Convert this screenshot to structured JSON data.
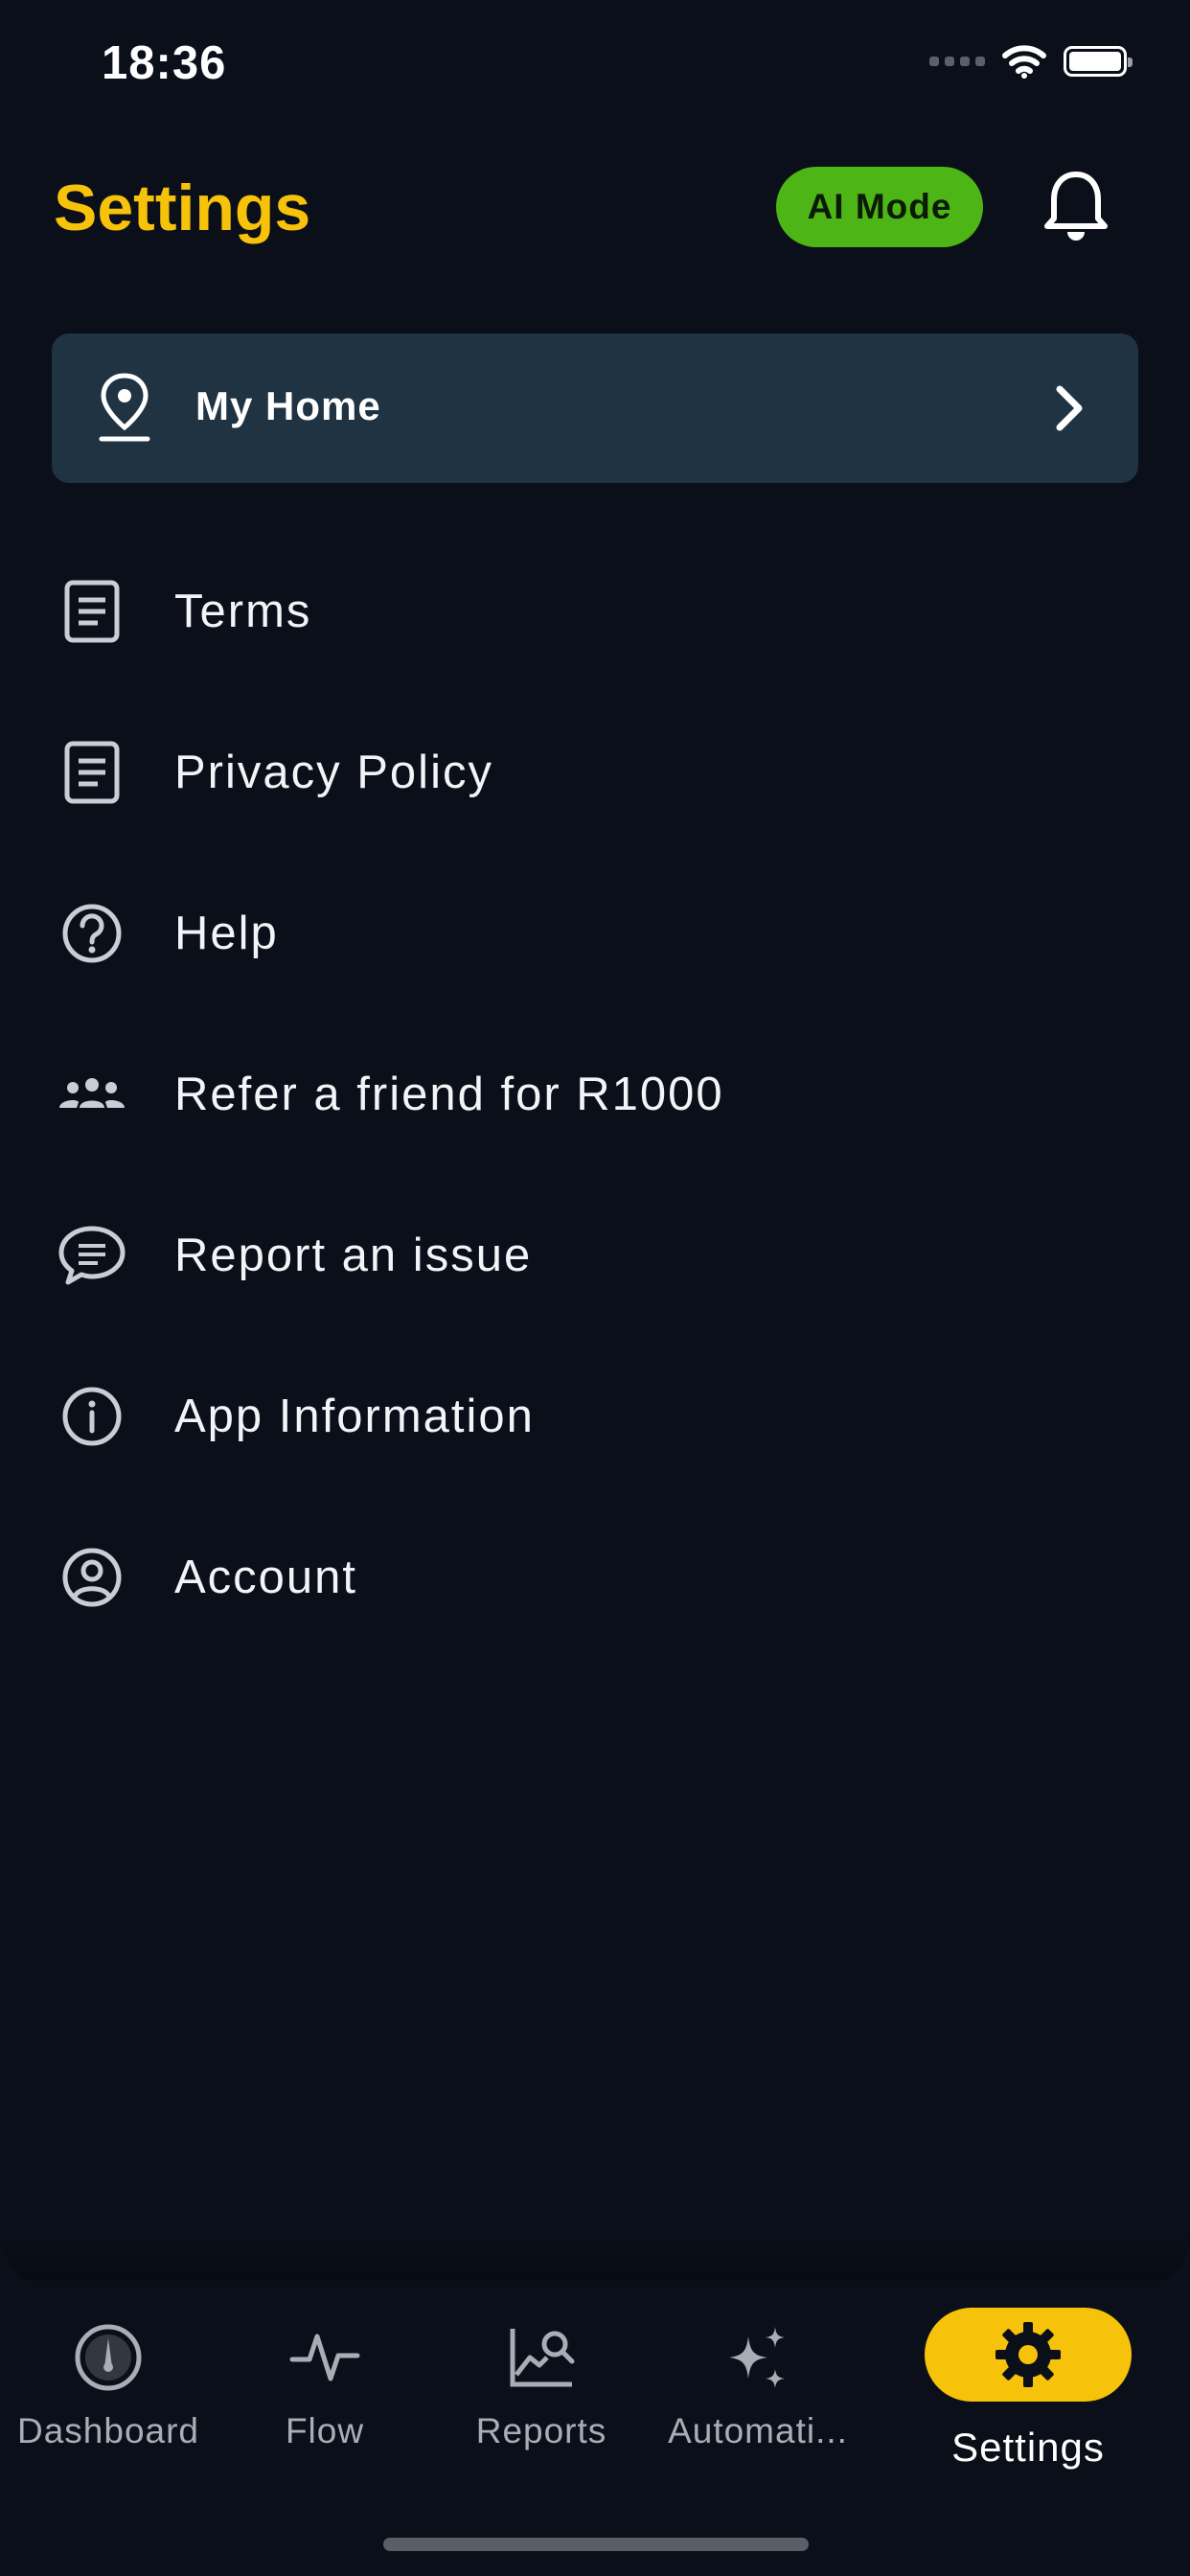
{
  "status_bar": {
    "time": "18:36"
  },
  "header": {
    "title": "Settings",
    "ai_mode_label": "AI Mode"
  },
  "home_card": {
    "label": "My Home"
  },
  "menu": {
    "items": [
      {
        "label": "Terms",
        "icon": "document-icon"
      },
      {
        "label": "Privacy Policy",
        "icon": "document-icon"
      },
      {
        "label": "Help",
        "icon": "question-circle-icon"
      },
      {
        "label": "Refer a friend for R1000",
        "icon": "users-group-icon"
      },
      {
        "label": "Report an issue",
        "icon": "chat-bubble-icon"
      },
      {
        "label": "App Information",
        "icon": "info-circle-icon"
      },
      {
        "label": "Account",
        "icon": "user-circle-icon"
      }
    ]
  },
  "tabbar": {
    "tabs": [
      {
        "label": "Dashboard",
        "icon": "gauge-icon"
      },
      {
        "label": "Flow",
        "icon": "pulse-icon"
      },
      {
        "label": "Reports",
        "icon": "chart-search-icon"
      },
      {
        "label": "Automati...",
        "icon": "sparkles-icon"
      },
      {
        "label": "Settings",
        "icon": "gear-icon",
        "active": true
      }
    ]
  },
  "colors": {
    "background": "#0b0f19",
    "accent": "#f7c20a",
    "ai_mode": "#4db516",
    "card": "#1f3343"
  }
}
